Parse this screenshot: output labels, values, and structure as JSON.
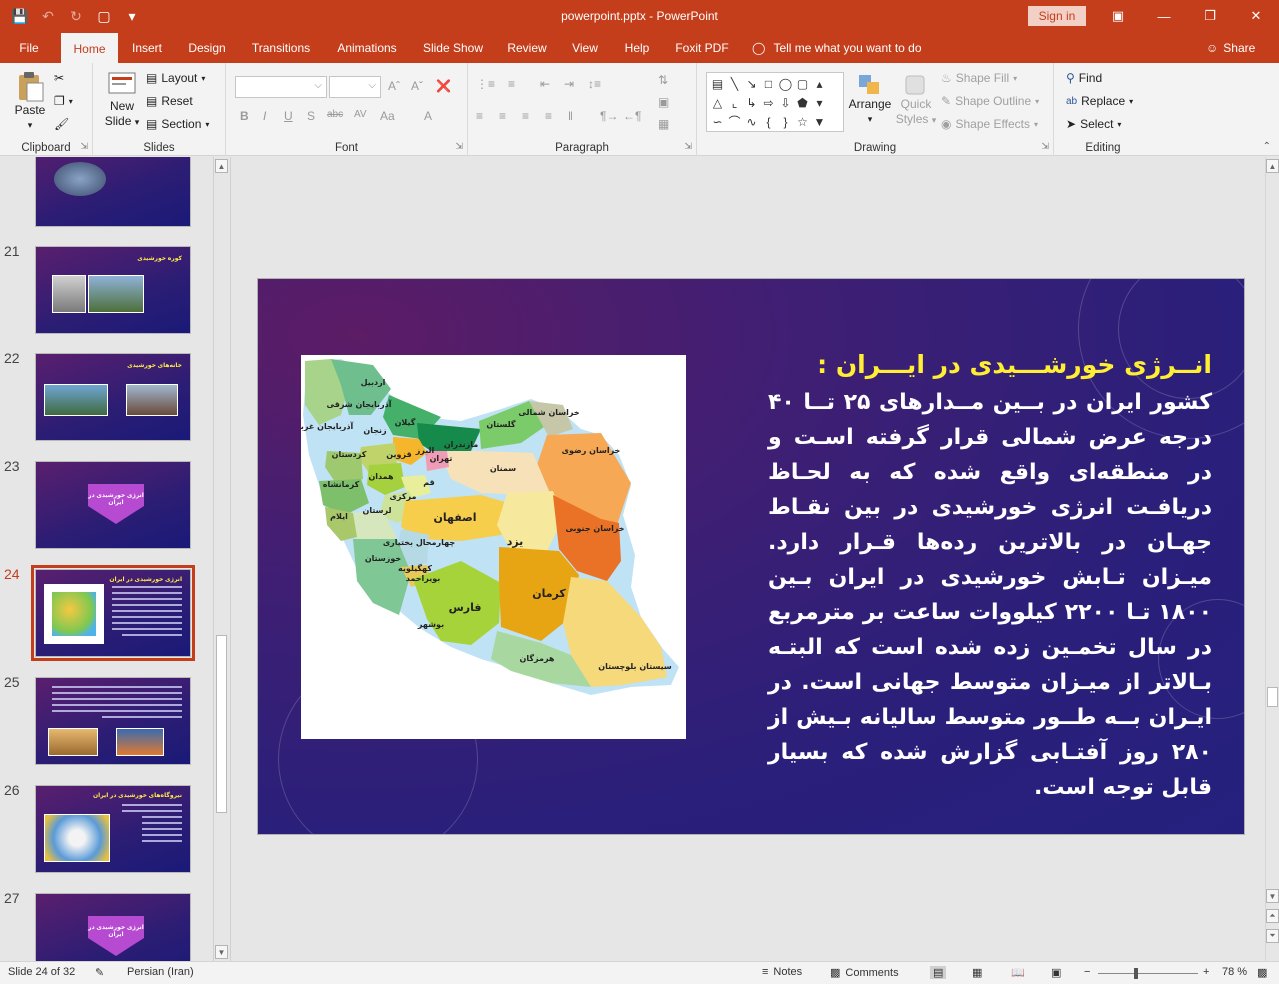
{
  "window": {
    "title": "powerpoint.pptx  -  PowerPoint",
    "sign_in": "Sign in"
  },
  "tabs": [
    "File",
    "Home",
    "Insert",
    "Design",
    "Transitions",
    "Animations",
    "Slide Show",
    "Review",
    "View",
    "Help",
    "Foxit PDF"
  ],
  "active_tab": "Home",
  "tell_me": "Tell me what you want to do",
  "share": "Share",
  "ribbon": {
    "clipboard": {
      "label": "Clipboard",
      "paste": "Paste"
    },
    "slides": {
      "label": "Slides",
      "new_slide": "New",
      "new_slide2": "Slide",
      "layout": "Layout",
      "reset": "Reset",
      "section": "Section"
    },
    "font": {
      "label": "Font"
    },
    "paragraph": {
      "label": "Paragraph"
    },
    "drawing": {
      "label": "Drawing",
      "arrange": "Arrange",
      "quick_styles": "Quick",
      "quick_styles2": "Styles",
      "shape_fill": "Shape Fill",
      "shape_outline": "Shape Outline",
      "shape_effects": "Shape Effects"
    },
    "editing": {
      "label": "Editing",
      "find": "Find",
      "replace": "Replace",
      "select": "Select"
    }
  },
  "thumbnails": [
    {
      "num": "21",
      "title": "کوره خورشیدی"
    },
    {
      "num": "22",
      "title": "خانه‌های خورشیدی"
    },
    {
      "num": "23",
      "title": "انرژی خورشیدی در ایران"
    },
    {
      "num": "24",
      "title": "انرژی خورشیدی در ایران"
    },
    {
      "num": "25",
      "title": ""
    },
    {
      "num": "26",
      "title": "نیروگاه‌های خورشیدی در ایران"
    },
    {
      "num": "27",
      "title": "انرژی خورشیدی در ایران"
    }
  ],
  "slide": {
    "title": "انــرژی خورشـــیدی در ایـــران :",
    "body": "کشور ایران در بــین مــدارهای ۲۵ تــا ۴۰ درجه عرض شمالی قرار گرفته اسـت و در منطقه‌ای واقع شده که به لحـاظ دریافـت انرژی خورشیدی در بین نقـاط جهـان در بالاترین رده‌ها قـرار دارد. میـزان تـابش خورشیدی در ایران بـین ۱۸۰۰ تـا ۲۲۰۰ کیلووات ساعت بر مترمربع در سال تخمـین زده شده است که البتـه بـالاتر از میـزان متوسط جهانی است. در ایـران بــه طــور متوسط سالیانه بـیش از ۲۸۰ روز آفتـابی گزارش شده که بسیار قابل توجه است."
  },
  "map_labels": [
    "اردبیل",
    "آذربایجان شرقی",
    "آذربایجان غربی",
    "زنجان",
    "گیلان",
    "مازندران",
    "گلستان",
    "خراسان شمالی",
    "خراسان رضوی",
    "سمنان",
    "تهران",
    "البرز",
    "قزوین",
    "همدان",
    "کردستان",
    "کرمانشاه",
    "قم",
    "مرکزی",
    "لرستان",
    "ایلام",
    "اصفهان",
    "یزد",
    "خراسان جنوبی",
    "چهارمحال بختیاری",
    "خوزستان",
    "کهگیلویه",
    "بویراحمد",
    "فارس",
    "کرمان",
    "بوشهر",
    "هرمزگان",
    "سیستان بلوچستان"
  ],
  "status": {
    "slide_info": "Slide 24 of 32",
    "language": "Persian (Iran)",
    "notes": "Notes",
    "comments": "Comments",
    "zoom": "78 %"
  },
  "colors": {
    "accent": "#c43e1c",
    "slide_title": "#ffee33"
  }
}
